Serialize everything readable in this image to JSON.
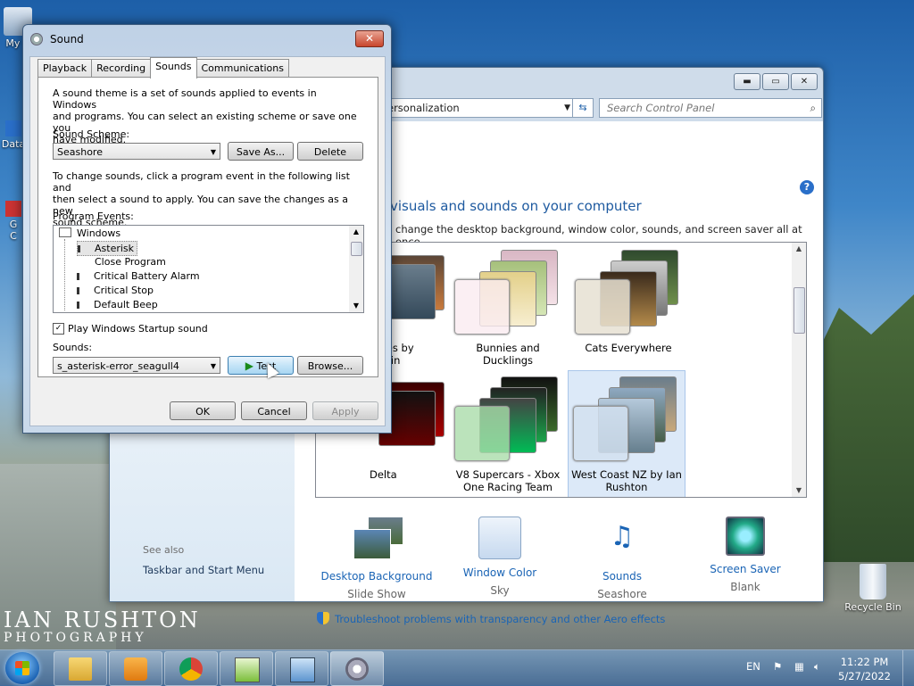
{
  "desktop": {
    "icons": [
      {
        "label": "My C"
      },
      {
        "label": "Data"
      },
      {
        "label": "G"
      },
      {
        "label": "C"
      },
      {
        "label": "Recycle Bin"
      }
    ],
    "watermark_line1": "IAN RUSHTON",
    "watermark_line2": "PHOTOGRAPHY"
  },
  "control_panel": {
    "address": "ersonalization",
    "search_placeholder": "Search Control Panel",
    "heading": "visuals and sounds on your computer",
    "subheading": "change the desktop background, window color, sounds, and screen saver all at once.",
    "themes": [
      {
        "name": "hores by\nGorlin"
      },
      {
        "name": "Bunnies and Ducklings"
      },
      {
        "name": "Cats Everywhere"
      },
      {
        "name": "Delta"
      },
      {
        "name": "V8 Supercars - Xbox One Racing Team"
      },
      {
        "name": "West Coast NZ by Ian Rushton",
        "selected": true
      }
    ],
    "bottom_items": [
      {
        "title": "Desktop Background",
        "value": "Slide Show"
      },
      {
        "title": "Window Color",
        "value": "Sky"
      },
      {
        "title": "Sounds",
        "value": "Seashore"
      },
      {
        "title": "Screen Saver",
        "value": "Blank"
      }
    ],
    "see_also_label": "See also",
    "see_also_link": "Taskbar and Start Menu",
    "troubleshoot_link": "Troubleshoot problems with transparency and other Aero effects"
  },
  "sound_dialog": {
    "title": "Sound",
    "tabs": [
      "Playback",
      "Recording",
      "Sounds",
      "Communications"
    ],
    "active_tab": "Sounds",
    "intro_line1": "A sound theme is a set of sounds applied to events in Windows",
    "intro_line2": "and programs.  You can select an existing scheme or save one you",
    "intro_line3": "have modified.",
    "scheme_label": "Sound Scheme:",
    "scheme_value": "Seashore",
    "save_as_label": "Save As...",
    "delete_label": "Delete",
    "change_line1": "To change sounds, click a program event in the following list and",
    "change_line2": "then select a sound to apply.  You can save the changes as a new",
    "change_line3": "sound scheme.",
    "events_label": "Program Events:",
    "events_group": "Windows",
    "events": [
      "Asterisk",
      "Close Program",
      "Critical Battery Alarm",
      "Critical Stop",
      "Default Beep"
    ],
    "startup_checkbox_label": "Play Windows Startup sound",
    "startup_checked": true,
    "sounds_label": "Sounds:",
    "sound_value": "s_asterisk-error_seagull4",
    "test_label": "Test",
    "browse_label": "Browse...",
    "ok_label": "OK",
    "cancel_label": "Cancel",
    "apply_label": "Apply"
  },
  "taskbar": {
    "language": "EN",
    "time": "11:22 PM",
    "date": "5/27/2022"
  }
}
